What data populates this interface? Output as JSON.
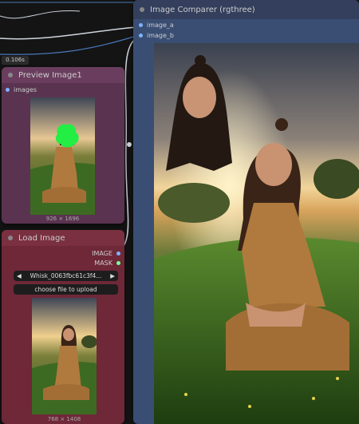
{
  "timing_badge": "0.106s",
  "image_comparer": {
    "title": "Image Comparer (rgthree)",
    "inputs": [
      "image_a",
      "image_b"
    ]
  },
  "preview_image": {
    "title": "Preview Image1",
    "input": "images",
    "dimensions": "926 × 1696"
  },
  "load_image": {
    "title": "Load Image",
    "outputs": [
      "IMAGE",
      "MASK"
    ],
    "filename": "Whisk_0063fbc61c3f4...",
    "upload_label": "choose file to upload",
    "dimensions": "768 × 1408"
  },
  "colors": {
    "canvas": "#141414",
    "comparer_body": "#3a4e74",
    "comparer_title": "#333f5c",
    "preview_body": "#5a3350",
    "preview_title": "#6a3d5e",
    "load_body": "#6e2838",
    "load_title": "#7a3040",
    "mask_green": "#22ee44",
    "wire": "#cfd5de"
  },
  "icons": {
    "node_dot": "circle",
    "combo_left": "triangle-left",
    "combo_right": "triangle-right"
  }
}
